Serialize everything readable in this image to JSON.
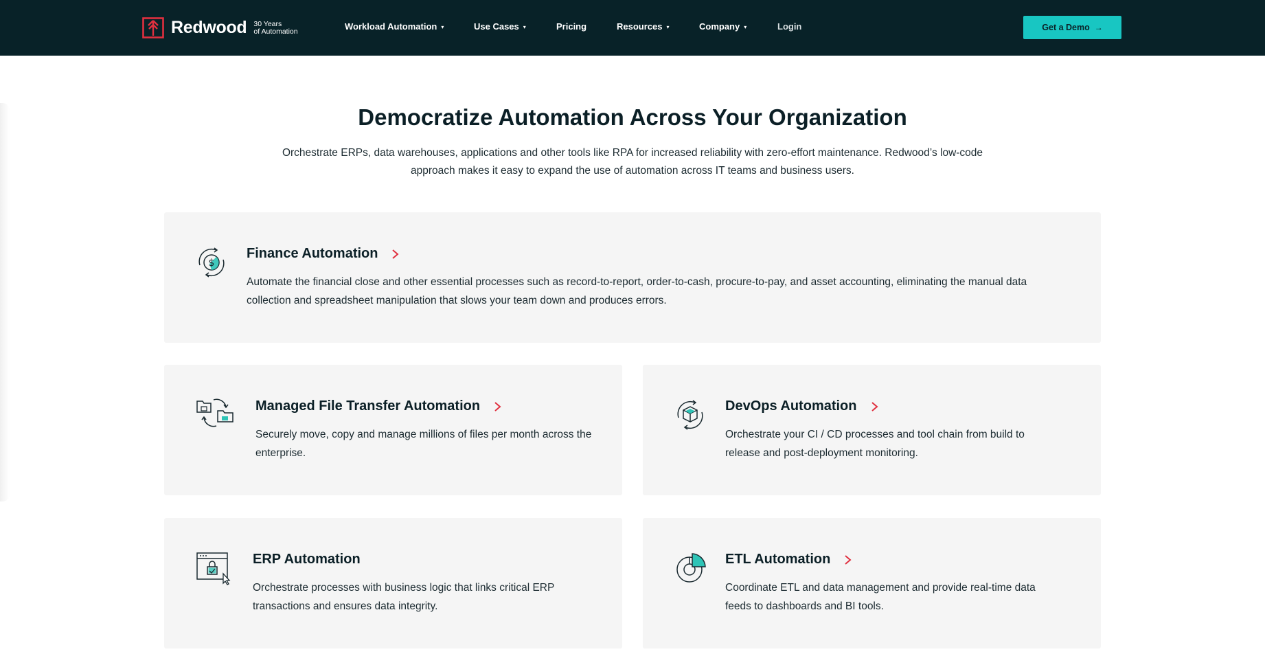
{
  "nav": {
    "logo_text": "Redwood",
    "logo_tagline_1": "30 Years",
    "logo_tagline_2": "of Automation",
    "items": [
      {
        "label": "Workload Automation",
        "has_dropdown": true
      },
      {
        "label": "Use Cases",
        "has_dropdown": true
      },
      {
        "label": "Pricing",
        "has_dropdown": false
      },
      {
        "label": "Resources",
        "has_dropdown": true
      },
      {
        "label": "Company",
        "has_dropdown": true
      },
      {
        "label": "Login",
        "has_dropdown": false
      }
    ],
    "cta_label": "Get a Demo",
    "caret_glyph": "▾",
    "arrow_glyph": "→"
  },
  "hero": {
    "title": "Democratize Automation Across Your Organization",
    "subtitle": "Orchestrate ERPs, data warehouses, applications and other tools like RPA for increased reliability with zero-effort maintenance. Redwood’s low-code approach makes it easy to expand the use of automation across IT teams and business users."
  },
  "cards": [
    {
      "title": "Finance Automation",
      "icon": "finance-dollar-cycle-icon",
      "description": "Automate the financial close and other essential processes such as record-to-report, order-to-cash, procure-to-pay, and asset accounting, eliminating the manual data collection and spreadsheet manipulation that slows your team down and produces errors."
    },
    {
      "title": "Managed File Transfer Automation",
      "icon": "file-transfer-folders-icon",
      "description": "Securely move, copy and manage millions of files per month across the enterprise."
    },
    {
      "title": "DevOps Automation",
      "icon": "devops-cube-cycle-icon",
      "description": "Orchestrate your CI / CD processes and tool chain from build to release and post-deployment monitoring."
    },
    {
      "title": "ERP Automation",
      "icon": "erp-window-lock-icon",
      "description": "Orchestrate processes with business logic that links critical ERP transactions and ensures data integrity."
    },
    {
      "title": "ETL Automation",
      "icon": "etl-pie-chart-icon",
      "description": "Coordinate ETL and data management and provide real-time data feeds to dashboards and BI tools."
    }
  ],
  "colors": {
    "nav_bg": "#082228",
    "accent_teal": "#18c6c2",
    "brand_red": "#e0303f",
    "card_bg": "#f5f5f5"
  }
}
